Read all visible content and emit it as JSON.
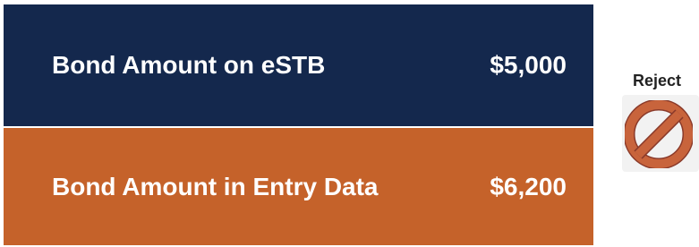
{
  "rows": [
    {
      "label": "Bond Amount on eSTB",
      "amount": "$5,000",
      "color": "#14284d"
    },
    {
      "label": "Bond Amount in Entry Data",
      "amount": "$6,200",
      "color": "#c5622a"
    }
  ],
  "reject": {
    "label": "Reject",
    "icon": "prohibited-icon",
    "icon_color": "#c8643c"
  }
}
